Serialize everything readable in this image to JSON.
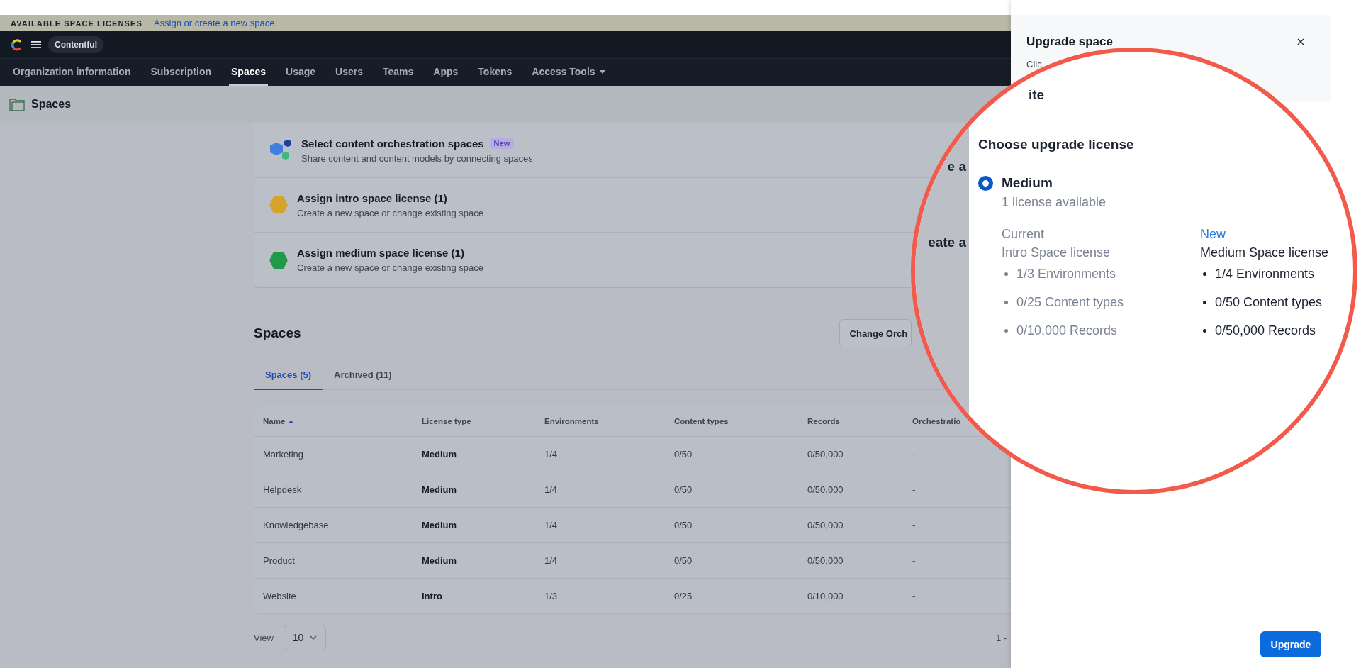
{
  "banner": {
    "title": "AVAILABLE SPACE LICENSES",
    "link": "Assign or create a new space"
  },
  "header": {
    "org": "Contentful"
  },
  "nav": [
    {
      "label": "Organization information",
      "selected": false,
      "dropdown": false
    },
    {
      "label": "Subscription",
      "selected": false,
      "dropdown": false
    },
    {
      "label": "Spaces",
      "selected": true,
      "dropdown": false
    },
    {
      "label": "Usage",
      "selected": false,
      "dropdown": false
    },
    {
      "label": "Users",
      "selected": false,
      "dropdown": false
    },
    {
      "label": "Teams",
      "selected": false,
      "dropdown": false
    },
    {
      "label": "Apps",
      "selected": false,
      "dropdown": false
    },
    {
      "label": "Tokens",
      "selected": false,
      "dropdown": false
    },
    {
      "label": "Access Tools",
      "selected": false,
      "dropdown": true
    }
  ],
  "page_title": "Spaces",
  "license_cards": [
    {
      "kind": "cubes",
      "title": "Select content orchestration spaces",
      "badge": "New",
      "subtitle": "Share content and content models by connecting spaces"
    },
    {
      "kind": "hexagon",
      "color": "#d4a52a",
      "title": "Assign intro space license (1)",
      "subtitle": "Create a new space or change existing space"
    },
    {
      "kind": "hexagon",
      "color": "#1f9a4a",
      "title": "Assign medium space license (1)",
      "subtitle": "Create a new space or change existing space"
    }
  ],
  "spaces_heading": "Spaces",
  "change_button": "Change Orch",
  "tabs": [
    {
      "label": "Spaces (5)",
      "selected": true
    },
    {
      "label": "Archived (11)",
      "selected": false
    }
  ],
  "table": {
    "columns": [
      {
        "label": "Name",
        "sorted": true
      },
      {
        "label": "License type",
        "sorted": false
      },
      {
        "label": "Environments",
        "sorted": false
      },
      {
        "label": "Content types",
        "sorted": false
      },
      {
        "label": "Records",
        "sorted": false
      },
      {
        "label": "Orchestratio",
        "sorted": false
      }
    ],
    "rows": [
      [
        "Marketing",
        "Medium",
        "1/4",
        "0/50",
        "0/50,000",
        "-"
      ],
      [
        "Helpdesk",
        "Medium",
        "1/4",
        "0/50",
        "0/50,000",
        "-"
      ],
      [
        "Knowledgebase",
        "Medium",
        "1/4",
        "0/50",
        "0/50,000",
        "-"
      ],
      [
        "Product",
        "Medium",
        "1/4",
        "0/50",
        "0/50,000",
        "-"
      ],
      [
        "Website",
        "Intro",
        "1/3",
        "0/25",
        "0/10,000",
        "-"
      ]
    ]
  },
  "view": {
    "label": "View",
    "value": "10"
  },
  "pagination": "1 -",
  "drawer": {
    "title": "Upgrade space",
    "description": "Clic",
    "button": "Upgrade"
  },
  "magnifier": {
    "top_fragment": "ite",
    "side_fragments": [
      "e a",
      "eate a"
    ],
    "heading": "Choose upgrade license",
    "options": [
      {
        "label": "Medium",
        "sub": "1 license available",
        "selected": true
      }
    ],
    "current": {
      "label": "Current",
      "name": "Intro Space license",
      "items": [
        "1/3 Environments",
        "0/25 Content types",
        "0/10,000 Records"
      ]
    },
    "new": {
      "label": "New",
      "name": "Medium Space license",
      "items": [
        "1/4 Environments",
        "0/50 Content types",
        "0/50,000 Records"
      ]
    }
  }
}
